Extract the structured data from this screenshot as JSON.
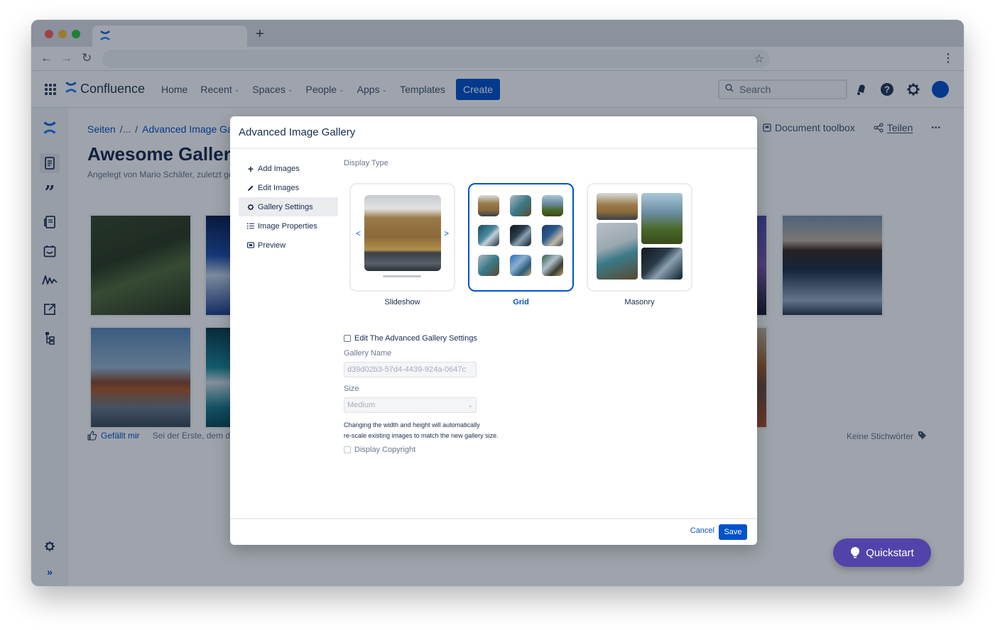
{
  "browser": {
    "new_tab_label": "+",
    "nav": {
      "back": "←",
      "forward": "→",
      "reload": "↻"
    },
    "bookmark_icon": "☆",
    "menu_icon": "⋮"
  },
  "header": {
    "brand": "Confluence",
    "nav": [
      {
        "label": "Home",
        "dropdown": false
      },
      {
        "label": "Recent",
        "dropdown": true
      },
      {
        "label": "Spaces",
        "dropdown": true
      },
      {
        "label": "People",
        "dropdown": true
      },
      {
        "label": "Apps",
        "dropdown": true
      },
      {
        "label": "Templates",
        "dropdown": false
      }
    ],
    "create_label": "Create",
    "search_placeholder": "Search",
    "accent": "#0052cc"
  },
  "page": {
    "breadcrumb": [
      "Seiten",
      "/...",
      "/",
      "Advanced Image Gal"
    ],
    "title": "Awesome Gallerie",
    "byline": "Angelegt von Mario Schäfer, zuletzt ge",
    "actions": {
      "toolbox": "Document toolbox",
      "share": "Teilen",
      "more": "•••"
    },
    "like_label": "Gefällt mir",
    "first_like": "Sei der Erste, dem di",
    "labels_text": "Keine Stichwörter"
  },
  "quickstart": {
    "label": "Quickstart",
    "color": "#5243aa"
  },
  "modal": {
    "title": "Advanced Image Gallery",
    "nav": [
      {
        "icon": "plus",
        "label": "Add Images",
        "active": false
      },
      {
        "icon": "pencil",
        "label": "Edit Images",
        "active": false
      },
      {
        "icon": "gear",
        "label": "Gallery Settings",
        "active": true
      },
      {
        "icon": "list",
        "label": "Image Properties",
        "active": false
      },
      {
        "icon": "preview",
        "label": "Preview",
        "active": false
      }
    ],
    "display_type_label": "Display Type",
    "display_types": [
      {
        "label": "Slideshow",
        "selected": false
      },
      {
        "label": "Grid",
        "selected": true
      },
      {
        "label": "Masonry",
        "selected": false
      }
    ],
    "edit_advanced_label": "Edit The Advanced Gallery Settings",
    "edit_advanced_checked": false,
    "gallery_name_label": "Gallery Name",
    "gallery_name_value": "d39d02b3-57d4-4439-924a-0647c",
    "size_label": "Size",
    "size_value": "Medium",
    "help_line1": "Changing the width and height will automatically",
    "help_line2": "re-scale existing images to match the new gallery size.",
    "display_copyright_label": "Display Copyright",
    "display_copyright_checked": false,
    "cancel_label": "Cancel",
    "save_label": "Save"
  }
}
